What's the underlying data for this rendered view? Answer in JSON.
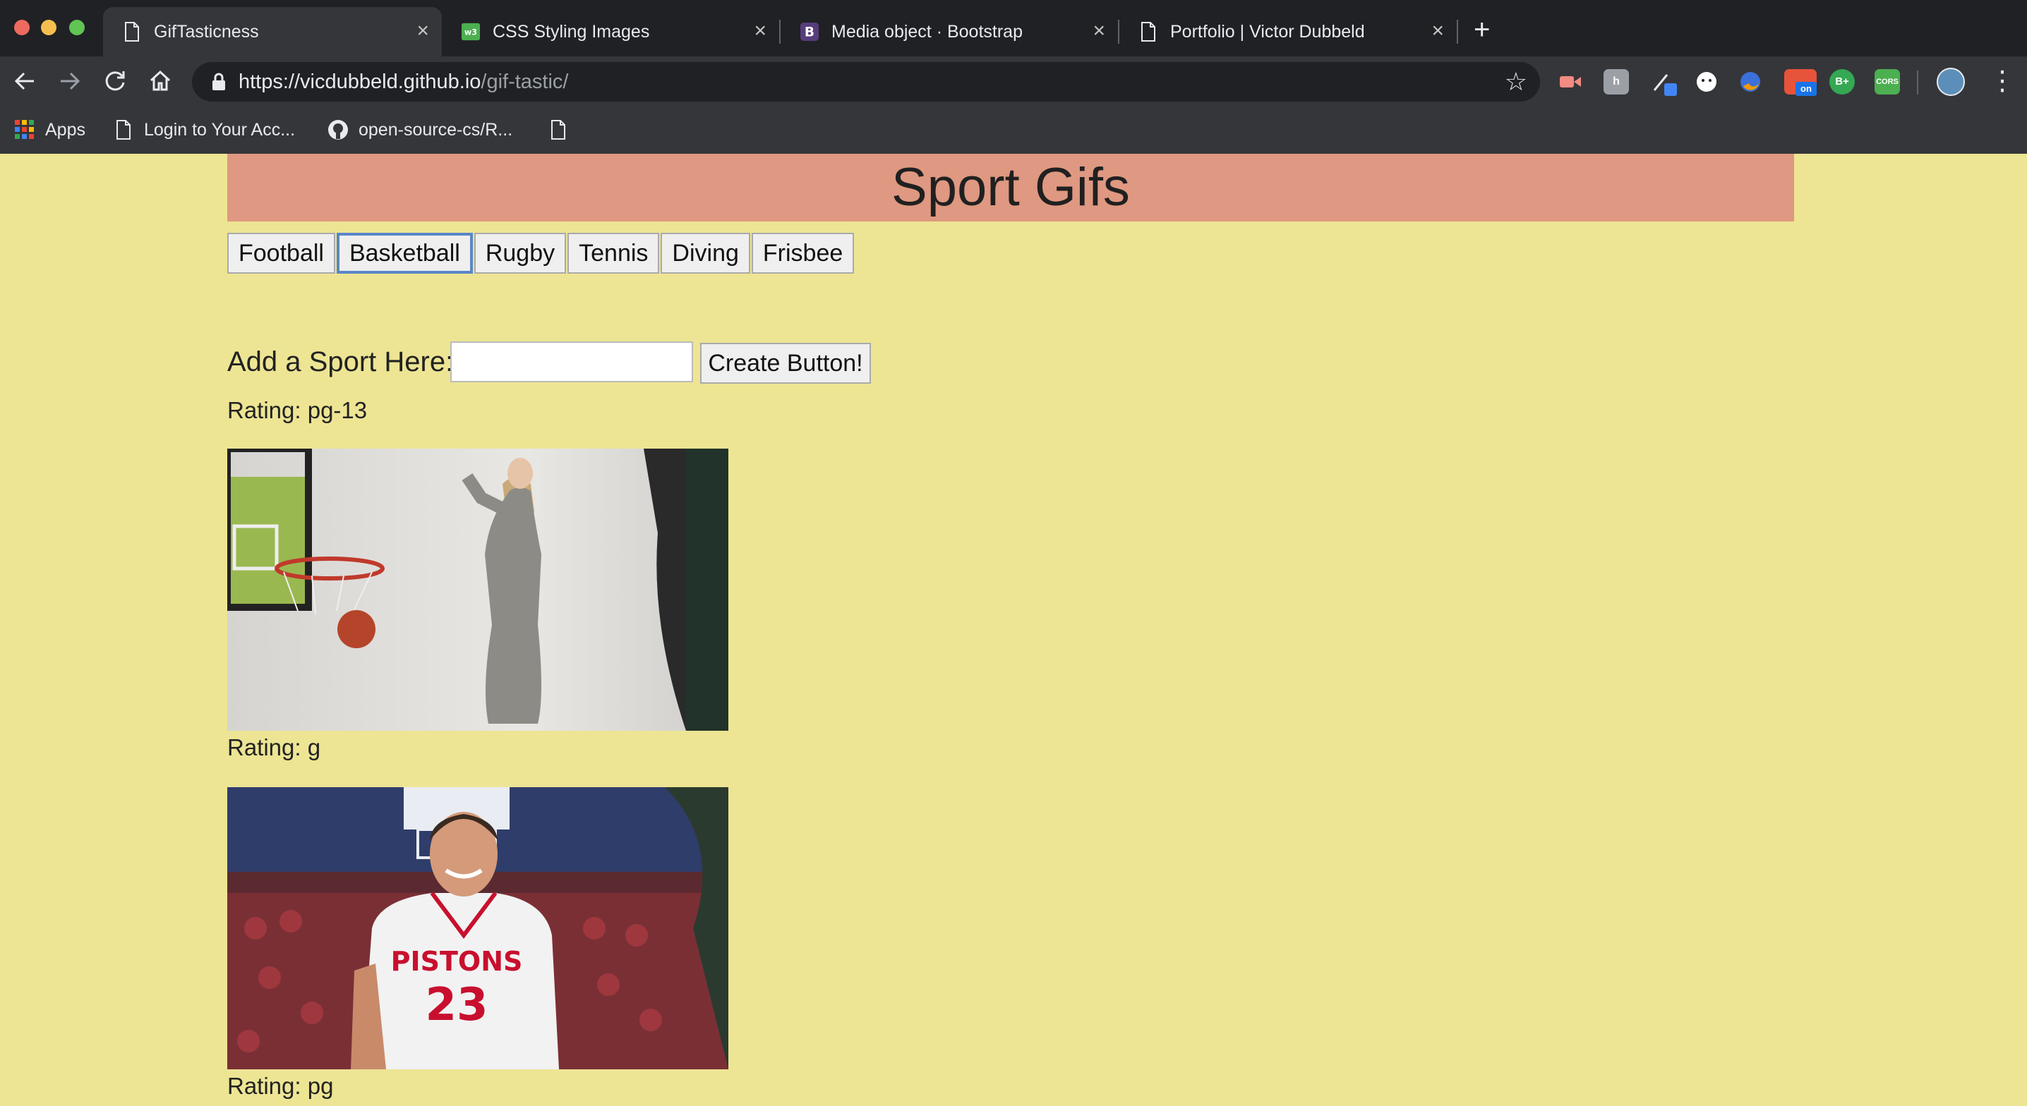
{
  "browser": {
    "tabs": [
      {
        "title": "GifTasticness",
        "icon": "page-icon"
      },
      {
        "title": "CSS Styling Images",
        "icon": "w3schools-icon"
      },
      {
        "title": "Media object · Bootstrap",
        "icon": "bootstrap-icon"
      },
      {
        "title": "Portfolio | Victor Dubbeld",
        "icon": "page-icon"
      }
    ],
    "url_host": "https://vicdubbeld.github.io",
    "url_path": "/gif-tastic/",
    "bookmarks": [
      {
        "label": "Apps",
        "icon": "apps-grid-icon"
      },
      {
        "label": "Login to Your Acc...",
        "icon": "page-icon"
      },
      {
        "label": "open-source-cs/R...",
        "icon": "github-icon"
      },
      {
        "label": "",
        "icon": "page-icon"
      }
    ],
    "extension_badges": {
      "b_plus": "B+",
      "cors": "CORS",
      "on": "on"
    }
  },
  "page": {
    "title": "Sport Gifs",
    "sports": [
      "Football",
      "Basketball",
      "Rugby",
      "Tennis",
      "Diving",
      "Frisbee"
    ],
    "focused_sport": "Basketball",
    "add_label": "Add a Sport Here:",
    "add_input_value": "",
    "create_button": "Create Button!",
    "gifs": [
      {
        "rating": "Rating: pg-13",
        "image": "woman in grey dress dribbling basketball at hoop"
      },
      {
        "rating": "Rating: g",
        "image": "Pistons player number 23 smiling on court"
      },
      {
        "rating": "Rating: pg",
        "image": ""
      }
    ],
    "jersey_text": "PISTONS",
    "jersey_number": "23"
  },
  "colors": {
    "page_bg": "#ede594",
    "banner_bg": "#df9881",
    "chrome_bg": "#35363a",
    "tabstrip_bg": "#202124",
    "focus_ring": "#5a86c8"
  }
}
